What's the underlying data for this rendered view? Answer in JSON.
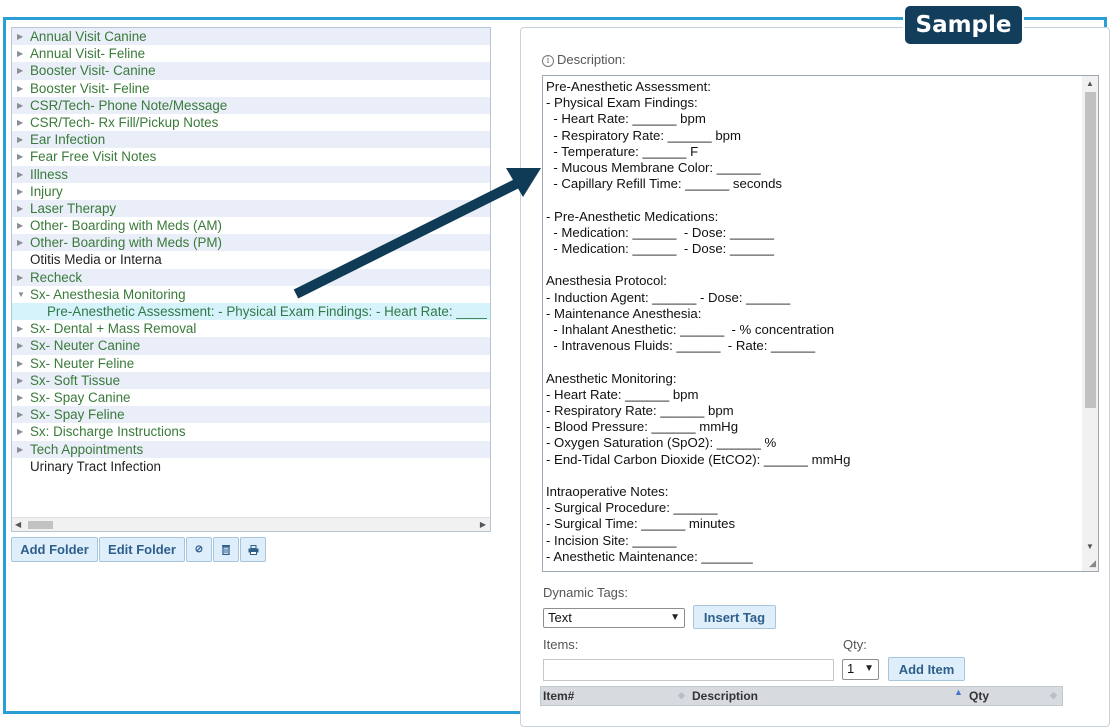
{
  "badge": "Sample",
  "tree": {
    "items": [
      {
        "label": "Annual Visit Canine",
        "type": "folder"
      },
      {
        "label": "Annual Visit- Feline",
        "type": "folder"
      },
      {
        "label": "Booster Visit- Canine",
        "type": "folder"
      },
      {
        "label": "Booster Visit- Feline",
        "type": "folder"
      },
      {
        "label": "CSR/Tech- Phone Note/Message",
        "type": "folder"
      },
      {
        "label": "CSR/Tech- Rx Fill/Pickup Notes",
        "type": "folder"
      },
      {
        "label": "Ear Infection",
        "type": "folder"
      },
      {
        "label": "Fear Free Visit Notes",
        "type": "folder"
      },
      {
        "label": "Illness",
        "type": "folder"
      },
      {
        "label": "Injury",
        "type": "folder"
      },
      {
        "label": "Laser Therapy",
        "type": "folder"
      },
      {
        "label": "Other- Boarding with Meds (AM)",
        "type": "folder"
      },
      {
        "label": "Other- Boarding with Meds (PM)",
        "type": "folder"
      },
      {
        "label": "Otitis Media or Interna",
        "type": "leaf"
      },
      {
        "label": "Recheck",
        "type": "folder"
      },
      {
        "label": "Sx- Anesthesia Monitoring",
        "type": "open"
      },
      {
        "label": "Pre-Anesthetic Assessment: - Physical Exam Findings: - Heart Rate: ______ bpm",
        "type": "child"
      },
      {
        "label": "Sx- Dental + Mass Removal",
        "type": "folder"
      },
      {
        "label": "Sx- Neuter Canine",
        "type": "folder"
      },
      {
        "label": "Sx- Neuter Feline",
        "type": "folder"
      },
      {
        "label": "Sx- Soft Tissue",
        "type": "folder"
      },
      {
        "label": "Sx- Spay Canine",
        "type": "folder"
      },
      {
        "label": "Sx- Spay Feline",
        "type": "folder"
      },
      {
        "label": "Sx: Discharge Instructions",
        "type": "folder"
      },
      {
        "label": "Tech Appointments",
        "type": "folder"
      },
      {
        "label": "Urinary Tract Infection",
        "type": "leaf"
      }
    ]
  },
  "buttons": {
    "add_folder": "Add Folder",
    "edit_folder": "Edit Folder",
    "insert_tag": "Insert Tag",
    "add_item": "Add Item"
  },
  "description": {
    "label": "Description:",
    "text": "Pre-Anesthetic Assessment:\n- Physical Exam Findings:\n  - Heart Rate: ______ bpm\n  - Respiratory Rate: ______ bpm\n  - Temperature: ______ F\n  - Mucous Membrane Color: ______\n  - Capillary Refill Time: ______ seconds\n\n- Pre-Anesthetic Medications:\n  - Medication: ______  - Dose: ______\n  - Medication: ______  - Dose: ______\n\nAnesthesia Protocol:\n- Induction Agent: ______ - Dose: ______\n- Maintenance Anesthesia:\n  - Inhalant Anesthetic: ______  - % concentration\n  - Intravenous Fluids: ______  - Rate: ______\n\nAnesthetic Monitoring:\n- Heart Rate: ______ bpm\n- Respiratory Rate: ______ bpm\n- Blood Pressure: ______ mmHg\n- Oxygen Saturation (SpO2): ______ %\n- End-Tidal Carbon Dioxide (EtCO2): ______ mmHg\n\nIntraoperative Notes:\n- Surgical Procedure: ______\n- Surgical Time: ______ minutes\n- Incision Site: ______\n- Anesthetic Maintenance: _______"
  },
  "dynamic_tags": {
    "label": "Dynamic Tags:",
    "selected": "Text"
  },
  "items": {
    "label": "Items:",
    "value": "",
    "qty_label": "Qty:",
    "qty_selected": "1"
  },
  "grid": {
    "columns": [
      "Item#",
      "Description",
      "Qty"
    ]
  },
  "colors": {
    "frame": "#2a9fd6",
    "badge_bg": "#123e5c",
    "arrow": "#0f3b57",
    "folder_text": "#3a7a3a"
  },
  "icons": {
    "tree_collapsed": "triangle-right-icon",
    "tree_expanded": "triangle-down-icon",
    "btn3": "ban-icon",
    "btn4": "trash-icon",
    "btn5": "print-icon"
  }
}
